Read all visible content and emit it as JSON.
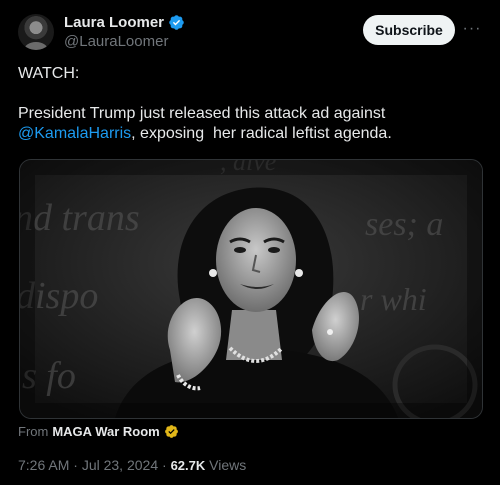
{
  "author": {
    "name": "Laura Loomer",
    "handle": "@LauraLoomer"
  },
  "actions": {
    "subscribe_label": "Subscribe",
    "more_label": "···"
  },
  "post": {
    "line1": "WATCH:",
    "line2": "President Trump just released this attack ad against",
    "mention": "@KamalaHarris",
    "line3_rest": ", exposing  her radical leftist agenda."
  },
  "media": {
    "from_prefix": "From",
    "source_name": "MAGA War Room"
  },
  "meta": {
    "time": "7:26 AM",
    "separator1": " · ",
    "date": "Jul 23, 2024",
    "separator2": " · ",
    "views_count": "62.7K",
    "views_label": " Views"
  },
  "colors": {
    "background": "#000000",
    "text": "#e7e9ea",
    "secondary": "#71767b",
    "link": "#1d9bf0",
    "verified_blue": "#1d9bf0",
    "verified_gold": "#e2b719"
  }
}
